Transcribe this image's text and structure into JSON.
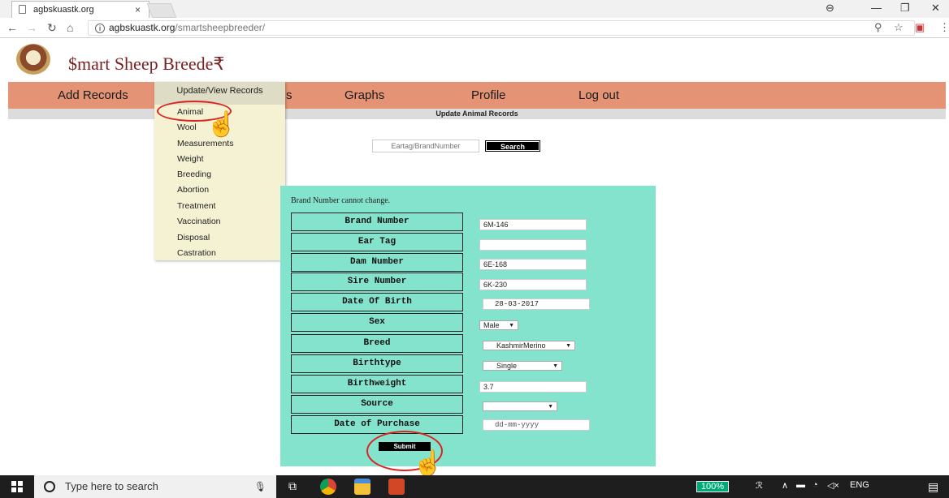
{
  "browser": {
    "tab_title": "agbskuastk.org",
    "tab_close": "×",
    "url_domain": "agbskuastk.org",
    "url_path": "/smartsheepbreeder/",
    "window_controls": [
      "⊖",
      "—",
      "❐",
      "✕"
    ]
  },
  "site": {
    "title": "$mart Sheep Breede₹"
  },
  "nav": {
    "items": [
      "Add Records",
      "Update/View Records",
      "Graphs",
      "Profile",
      "Log out"
    ],
    "visible_fragment": "s"
  },
  "subheader": "Update Animal Records",
  "dropdown": {
    "items": [
      "Animal",
      "Wool",
      "Measurements",
      "Weight",
      "Breeding",
      "Abortion",
      "Treatment",
      "Vaccination",
      "Disposal",
      "Castration"
    ]
  },
  "search": {
    "placeholder": "Eartag/BrandNumber",
    "button": "Search"
  },
  "form": {
    "note": "Brand Number cannot change.",
    "fields": [
      {
        "label": "Brand Number",
        "value": "6M-146"
      },
      {
        "label": "Ear Tag",
        "value": ""
      },
      {
        "label": "Dam Number",
        "value": "6E-168"
      },
      {
        "label": "Sire Number",
        "value": "6K-230"
      },
      {
        "label": "Date Of Birth",
        "value": "28-03-2017"
      },
      {
        "label": "Sex",
        "value": "Male"
      },
      {
        "label": "Breed",
        "value": "KashmirMerino"
      },
      {
        "label": "Birthtype",
        "value": "Single"
      },
      {
        "label": "Birthweight",
        "value": "3.7"
      },
      {
        "label": "Source",
        "value": ""
      },
      {
        "label": "Date of Purchase",
        "value": "dd-mm-yyyy"
      }
    ],
    "submit": "Submit"
  },
  "taskbar": {
    "search_placeholder": "Type here to search",
    "zoom": "100%",
    "language": "ENG"
  },
  "colors": {
    "navbar": "#e59375",
    "panel": "#84e3cc",
    "dropdown": "#f5f2d4",
    "highlight_oval": "#d22222"
  }
}
